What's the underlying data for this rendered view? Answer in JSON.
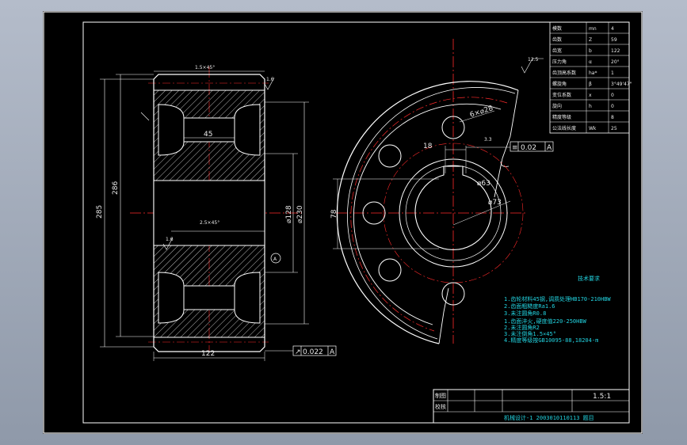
{
  "colors": {
    "background": "#000000",
    "border": "#ffffff",
    "centerline": "#ff2a2a",
    "dimension": "#22d3e0",
    "outline": "#ffffff",
    "hatch": "#eaeaea"
  },
  "side_view": {
    "chamfer_top": "1.5×45°",
    "chamfer_mid": "2.5×45°",
    "dim_45": "45",
    "dim_122": "122",
    "dim_285": "285",
    "dim_286": "286",
    "dim_128": "⌀128",
    "dim_230": "⌀230",
    "rough_top": "1.6",
    "rough_mid": "1.6",
    "datum": "A",
    "runout_value": "0.022",
    "runout_datum": "A"
  },
  "front_view": {
    "hole_dim": "6×⌀28",
    "dim_18": "18",
    "dim_3": "3.3",
    "dim_63": "⌀63",
    "dim_73": "⌀73",
    "dim_78": "78",
    "flatness_value": "0.02",
    "flatness_datum": "A",
    "rough_symbol": "12.5"
  },
  "param_table": [
    [
      "模数",
      "mn",
      "4"
    ],
    [
      "齿数",
      "Z",
      "59"
    ],
    [
      "齿宽",
      "b",
      "122"
    ],
    [
      "压力角",
      "α",
      "20°"
    ],
    [
      "齿顶高系数",
      "ha*",
      "1"
    ],
    [
      "螺旋角",
      "β",
      "3°49'47\""
    ],
    [
      "变位系数",
      "x",
      "0"
    ],
    [
      "旋向",
      "h",
      "0"
    ],
    [
      "精度等级",
      "",
      "8"
    ],
    [
      "公法线长度",
      "Wk",
      "25"
    ]
  ],
  "notes": {
    "title": "技术要求",
    "lines": [
      "1.齿轮材料45钢,调质处理HB170-210HBW",
      "2.齿面粗糙度Ra1.6",
      "3.未注圆角R0.8",
      "1.齿面淬火,硬度值220-250HBW",
      "2.未注圆角R2",
      "3.未注倒角1.5×45°",
      "4.精度等级按GB10095-88,18204-m"
    ]
  },
  "title_block": {
    "scale": "1.5:1",
    "row1_label": "制图",
    "row2_label": "校核",
    "footer": "机械设计-1  2003010110113  题目"
  }
}
